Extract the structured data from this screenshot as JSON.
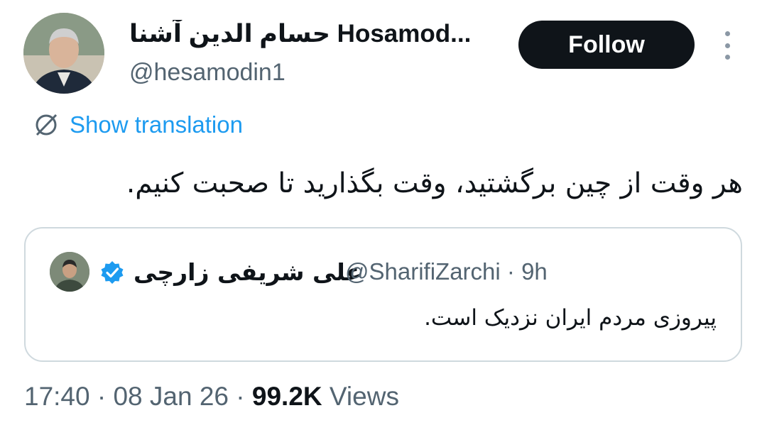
{
  "author": {
    "display_name": "حسام الدین آشنا Hosamod...",
    "handle": "@hesamodin1"
  },
  "follow_label": "Follow",
  "translation": {
    "label": "Show translation"
  },
  "body_text": "هر وقت از چین برگشتید، وقت بگذارید تا صحبت کنیم.",
  "quoted_tweet": {
    "display_name": "علی شریفی زارچی",
    "handle": "@SharifiZarchi",
    "time": "· 9h",
    "text": "پیروزی مردم ایران نزدیک است.",
    "verified": true
  },
  "meta": {
    "time": "17:40",
    "sep1": "·",
    "date": "08 Jan 26",
    "sep2": "·",
    "views_count": "99.2K",
    "views_label": "Views"
  },
  "colors": {
    "link_blue": "#1d9bf0",
    "text_primary": "#0f1419",
    "text_secondary": "#536471",
    "button_bg": "#0f1419",
    "border": "#cfd9de"
  }
}
